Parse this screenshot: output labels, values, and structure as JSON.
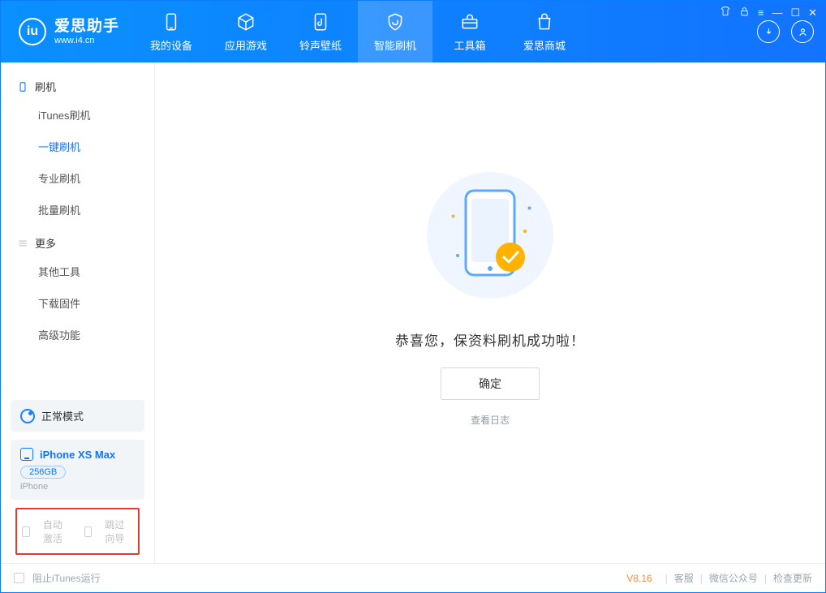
{
  "brand": {
    "name": "爱思助手",
    "url": "www.i4.cn"
  },
  "nav": {
    "items": [
      {
        "label": "我的设备"
      },
      {
        "label": "应用游戏"
      },
      {
        "label": "铃声壁纸"
      },
      {
        "label": "智能刷机"
      },
      {
        "label": "工具箱"
      },
      {
        "label": "爱思商城"
      }
    ],
    "active_index": 3
  },
  "sidebar": {
    "group1": {
      "title": "刷机",
      "items": [
        {
          "label": "iTunes刷机"
        },
        {
          "label": "一键刷机"
        },
        {
          "label": "专业刷机"
        },
        {
          "label": "批量刷机"
        }
      ],
      "active_index": 1
    },
    "group2": {
      "title": "更多",
      "items": [
        {
          "label": "其他工具"
        },
        {
          "label": "下载固件"
        },
        {
          "label": "高级功能"
        }
      ]
    },
    "status": {
      "label": "正常模式"
    },
    "device": {
      "name": "iPhone XS Max",
      "capacity": "256GB",
      "type": "iPhone"
    },
    "options": {
      "auto_activate": "自动激活",
      "skip_guide": "跳过向导"
    }
  },
  "main": {
    "message": "恭喜您，保资料刷机成功啦！",
    "ok": "确定",
    "view_log": "查看日志"
  },
  "footer": {
    "block_itunes": "阻止iTunes运行",
    "version": "V8.16",
    "support": "客服",
    "wechat": "微信公众号",
    "update": "检查更新"
  }
}
